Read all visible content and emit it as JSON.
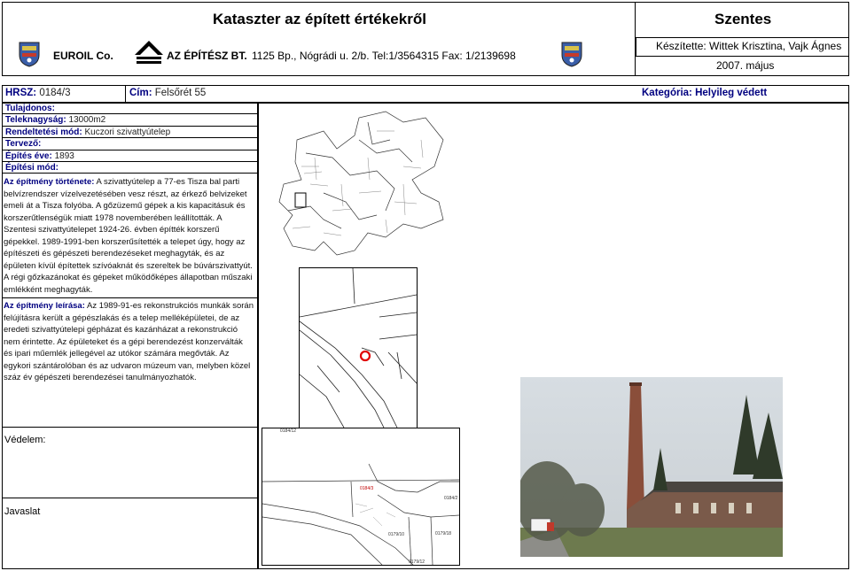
{
  "header": {
    "title": "Kataszter az épített értékekről",
    "city": "Szentes",
    "company1": "EUROIL Co.",
    "company2_name": "AZ ÉPÍTÉSZ BT.",
    "company2_address": "1125 Bp., Nógrádi u. 2/b. Tel:1/3564315 Fax: 1/2139698",
    "prepared_by": "Készítette: Wittek Krisztina, Vajk Ágnes",
    "date": "2007. május"
  },
  "record": {
    "hrsz_label": "HRSZ:",
    "hrsz_value": "0184/3",
    "cim_label": "Cím:",
    "cim_value": "Felsőrét 55",
    "kategoria": "Kategória: Helyileg védett"
  },
  "fields": {
    "tulajdonos_label": "Tulajdonos:",
    "teleknagysag_label": "Teleknagyság:",
    "teleknagysag_value": "13000m2",
    "rendeltetes_label": "Rendeltetési mód:",
    "rendeltetes_value": "Kuczori szivattyútelep",
    "tervezo_label": "Tervező:",
    "epites_eve_label": "Építés éve:",
    "epites_eve_value": "1893",
    "epitesi_mod_label": "Építési mód:"
  },
  "tortenet": {
    "label": "Az építmény története:",
    "text": "A szivattyútelep a 77-es Tisza bal parti belvízrendszer vízelvezetésében vesz részt, az érkező belvizeket emeli át a Tisza folyóba. A gőzüzemű gépek a kis kapacitásuk és korszerűtlenségük miatt 1978 novemberében leállították. A Szentesi szivattyútelepet 1924-26. évben építték korszerű gépekkel. 1989-1991-ben korszerűsítették a telepet úgy, hogy az építészeti és gépészeti berendezéseket meghagyták, és az épületen kívül építettek szívóaknát és szereltek be búvárszivattyút. A régi gőzkazánokat és gépeket működőképes állapotban műszaki emlékként meghagyták."
  },
  "leiras": {
    "label": "Az építmény leírása:",
    "text": "Az 1989-91-es rekonstrukciós munkák során felújításra került a gépészlakás és a telep melléképületei, de az eredeti szivattyútelepi gépházat és kazánházat a rekonstrukció nem érintette. Az épületeket és a gépi berendezést konzerválták és ipari műemlék jellegével az utókor számára megővták. Az egykori szántárolóban és az udvaron múzeum van, melyben közel száz év gépészeti berendezései tanulmányozhatók."
  },
  "vedelem_label": "Védelem:",
  "javaslat_label": "Javaslat",
  "map_labels": {
    "cadastral_top": "0184/12",
    "parcel": "0184/3",
    "lot_a": "0184/2",
    "lot_b": "0179/10",
    "lot_c": "0179/18",
    "lot_d": "0179/12"
  },
  "colors": {
    "label_blue": "#000080",
    "marker_red": "#e00000"
  }
}
